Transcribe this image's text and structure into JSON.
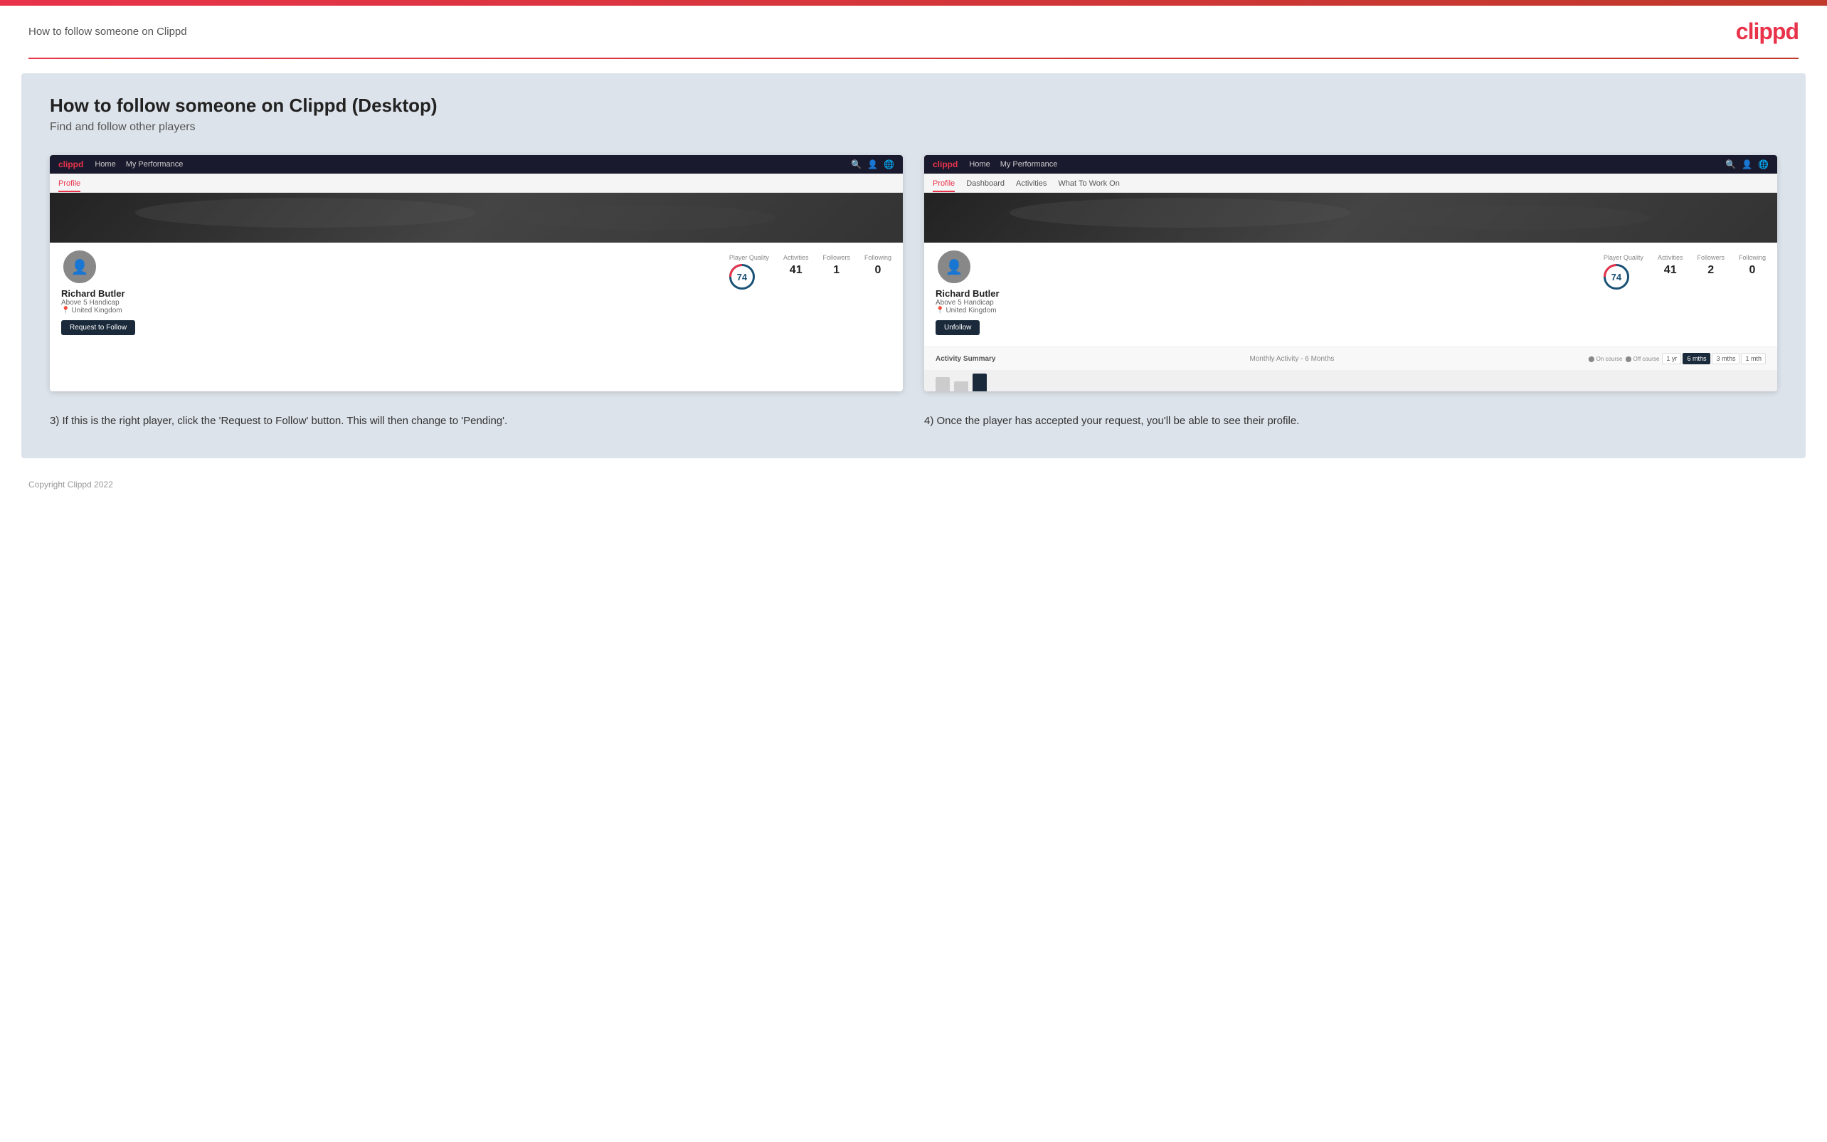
{
  "page": {
    "top_bar_color": "#e8334a",
    "header_title": "How to follow someone on Clippd",
    "logo": "clippd",
    "divider_color": "#e8334a"
  },
  "main": {
    "title": "How to follow someone on Clippd (Desktop)",
    "subtitle": "Find and follow other players",
    "background_color": "#dde3ea"
  },
  "screenshot_left": {
    "nav": {
      "logo": "clippd",
      "links": [
        "Home",
        "My Performance"
      ]
    },
    "tab": "Profile",
    "player": {
      "name": "Richard Butler",
      "handicap": "Above 5 Handicap",
      "location": "United Kingdom",
      "quality": "74",
      "activities": "41",
      "followers": "1",
      "following": "0"
    },
    "button": "Request to Follow",
    "labels": {
      "player_quality": "Player Quality",
      "activities": "Activities",
      "followers": "Followers",
      "following": "Following"
    }
  },
  "screenshot_right": {
    "nav": {
      "logo": "clippd",
      "links": [
        "Home",
        "My Performance"
      ]
    },
    "tabs": [
      "Profile",
      "Dashboard",
      "Activities",
      "What To Work On"
    ],
    "active_tab": "Profile",
    "player": {
      "name": "Richard Butler",
      "handicap": "Above 5 Handicap",
      "location": "United Kingdom",
      "quality": "74",
      "activities": "41",
      "followers": "2",
      "following": "0"
    },
    "button": "Unfollow",
    "labels": {
      "player_quality": "Player Quality",
      "activities": "Activities",
      "followers": "Followers",
      "following": "Following"
    },
    "activity_summary": {
      "label": "Activity Summary",
      "period_label": "Monthly Activity - 6 Months",
      "legend": [
        "On course",
        "Off course"
      ],
      "periods": [
        "1 yr",
        "6 mths",
        "3 mths",
        "1 mth"
      ],
      "active_period": "6 mths"
    }
  },
  "descriptions": {
    "left": "3) If this is the right player, click the 'Request to Follow' button. This will then change to 'Pending'.",
    "right": "4) Once the player has accepted your request, you'll be able to see their profile."
  },
  "footer": {
    "copyright": "Copyright Clippd 2022"
  }
}
